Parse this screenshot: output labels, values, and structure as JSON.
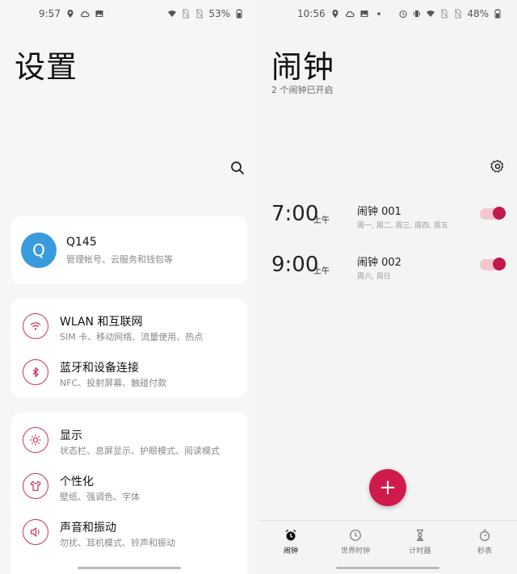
{
  "left": {
    "status": {
      "time": "9:57",
      "battery": "53%"
    },
    "title": "设置",
    "account": {
      "initial": "Q",
      "name": "Q145",
      "subtitle": "管理帐号、云服务和钱包等"
    },
    "group1": [
      {
        "title": "WLAN 和互联网",
        "subtitle": "SIM 卡、移动网络、流量使用、热点",
        "icon": "wifi-icon"
      },
      {
        "title": "蓝牙和设备连接",
        "subtitle": "NFC、投射屏幕、触碰付款",
        "icon": "bluetooth-icon"
      }
    ],
    "group2": [
      {
        "title": "显示",
        "subtitle": "状态栏、息屏显示、护眼模式、阅读模式",
        "icon": "brightness-icon"
      },
      {
        "title": "个性化",
        "subtitle": "壁纸、强调色、字体",
        "icon": "tshirt-icon"
      },
      {
        "title": "声音和振动",
        "subtitle": "勿扰、耳机模式、铃声和振动",
        "icon": "speaker-icon"
      }
    ]
  },
  "right": {
    "status": {
      "time": "10:56",
      "battery": "48%"
    },
    "title": "闹钟",
    "subtitle": "2 个闹钟已开启",
    "alarms": [
      {
        "time": "7:00",
        "ampm": "上午",
        "name": "闹钟 001",
        "days": "周一, 周二, 周三, 周四, 周五",
        "enabled": true
      },
      {
        "time": "9:00",
        "ampm": "上午",
        "name": "闹钟 002",
        "days": "周六, 周日",
        "enabled": true
      }
    ],
    "fab_label": "+",
    "nav": [
      {
        "label": "闹钟",
        "icon": "alarm-clock-icon",
        "active": true
      },
      {
        "label": "世界时钟",
        "icon": "clock-icon",
        "active": false
      },
      {
        "label": "计时器",
        "icon": "hourglass-icon",
        "active": false
      },
      {
        "label": "秒表",
        "icon": "stopwatch-icon",
        "active": false
      }
    ]
  },
  "colors": {
    "accent": "#cf1b4c",
    "avatar": "#3a9bdc",
    "card": "#ffffff",
    "background": "#f6f6f6"
  }
}
